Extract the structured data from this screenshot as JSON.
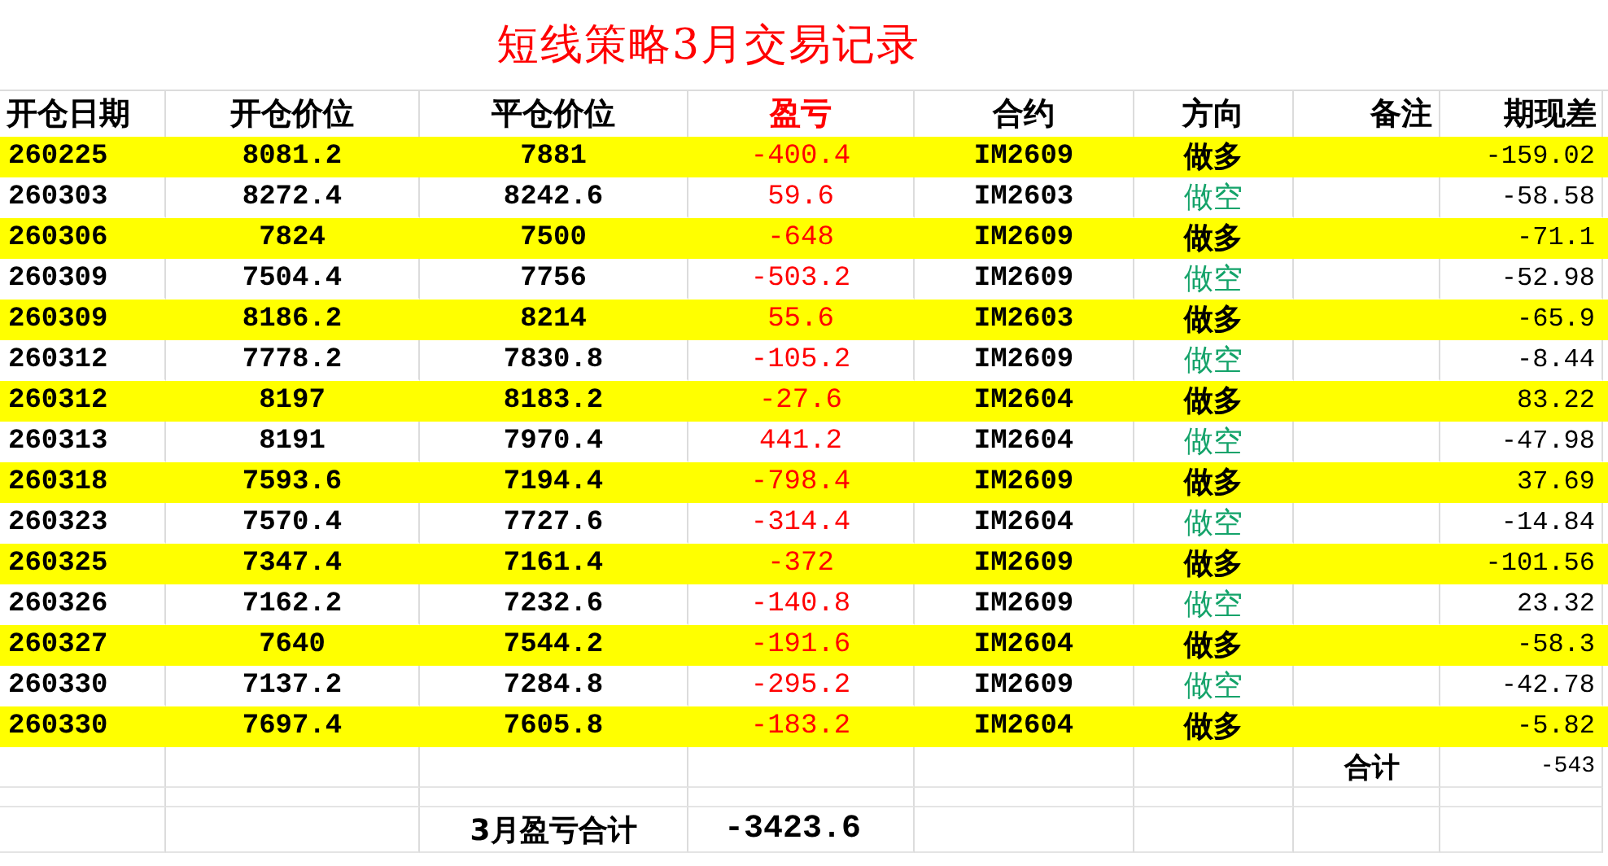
{
  "title": "短线策略3月交易记录",
  "columns": [
    "开仓日期",
    "开仓价位",
    "平仓价位",
    "盈亏",
    "合约",
    "方向",
    "备注",
    "期现差"
  ],
  "rows": [
    {
      "open_date": "260225",
      "open_price": "8081.2",
      "close_price": "7881",
      "pnl": "-400.4",
      "contract": "IM2609",
      "direction": "做多",
      "kind": "long",
      "basis": "-159.02"
    },
    {
      "open_date": "260303",
      "open_price": "8272.4",
      "close_price": "8242.6",
      "pnl": "59.6",
      "contract": "IM2603",
      "direction": "做空",
      "kind": "short",
      "basis": "-58.58"
    },
    {
      "open_date": "260306",
      "open_price": "7824",
      "close_price": "7500",
      "pnl": "-648",
      "contract": "IM2609",
      "direction": "做多",
      "kind": "long",
      "basis": "-71.1"
    },
    {
      "open_date": "260309",
      "open_price": "7504.4",
      "close_price": "7756",
      "pnl": "-503.2",
      "contract": "IM2609",
      "direction": "做空",
      "kind": "short",
      "basis": "-52.98"
    },
    {
      "open_date": "260309",
      "open_price": "8186.2",
      "close_price": "8214",
      "pnl": "55.6",
      "contract": "IM2603",
      "direction": "做多",
      "kind": "long",
      "basis": "-65.9"
    },
    {
      "open_date": "260312",
      "open_price": "7778.2",
      "close_price": "7830.8",
      "pnl": "-105.2",
      "contract": "IM2609",
      "direction": "做空",
      "kind": "short",
      "basis": "-8.44"
    },
    {
      "open_date": "260312",
      "open_price": "8197",
      "close_price": "8183.2",
      "pnl": "-27.6",
      "contract": "IM2604",
      "direction": "做多",
      "kind": "long",
      "basis": "83.22"
    },
    {
      "open_date": "260313",
      "open_price": "8191",
      "close_price": "7970.4",
      "pnl": "441.2",
      "contract": "IM2604",
      "direction": "做空",
      "kind": "short",
      "basis": "-47.98"
    },
    {
      "open_date": "260318",
      "open_price": "7593.6",
      "close_price": "7194.4",
      "pnl": "-798.4",
      "contract": "IM2609",
      "direction": "做多",
      "kind": "long",
      "basis": "37.69"
    },
    {
      "open_date": "260323",
      "open_price": "7570.4",
      "close_price": "7727.6",
      "pnl": "-314.4",
      "contract": "IM2604",
      "direction": "做空",
      "kind": "short",
      "basis": "-14.84"
    },
    {
      "open_date": "260325",
      "open_price": "7347.4",
      "close_price": "7161.4",
      "pnl": "-372",
      "contract": "IM2609",
      "direction": "做多",
      "kind": "long",
      "basis": "-101.56"
    },
    {
      "open_date": "260326",
      "open_price": "7162.2",
      "close_price": "7232.6",
      "pnl": "-140.8",
      "contract": "IM2609",
      "direction": "做空",
      "kind": "short",
      "basis": "23.32"
    },
    {
      "open_date": "260327",
      "open_price": "7640",
      "close_price": "7544.2",
      "pnl": "-191.6",
      "contract": "IM2604",
      "direction": "做多",
      "kind": "long",
      "basis": "-58.3"
    },
    {
      "open_date": "260330",
      "open_price": "7137.2",
      "close_price": "7284.8",
      "pnl": "-295.2",
      "contract": "IM2609",
      "direction": "做空",
      "kind": "short",
      "basis": "-42.78"
    },
    {
      "open_date": "260330",
      "open_price": "7697.4",
      "close_price": "7605.8",
      "pnl": "-183.2",
      "contract": "IM2604",
      "direction": "做多",
      "kind": "long",
      "basis": "-5.82"
    }
  ],
  "subtotal": {
    "label": "合计",
    "value": "-543"
  },
  "total": {
    "label": "3月盈亏合计",
    "value": "-3423.6"
  }
}
